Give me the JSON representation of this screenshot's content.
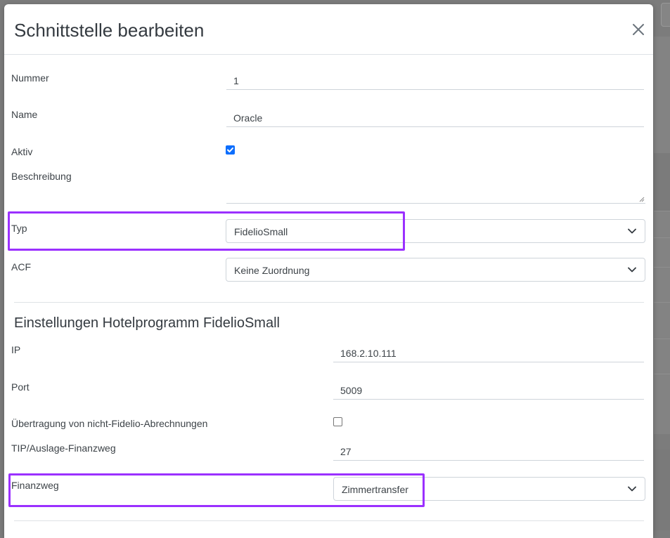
{
  "modal": {
    "title": "Schnittstelle bearbeiten"
  },
  "fields": {
    "nummer": {
      "label": "Nummer",
      "value": "1"
    },
    "name": {
      "label": "Name",
      "value": "Oracle"
    },
    "aktiv": {
      "label": "Aktiv",
      "checked": true
    },
    "beschreibung": {
      "label": "Beschreibung",
      "value": ""
    },
    "typ": {
      "label": "Typ",
      "value": "FidelioSmall"
    },
    "acf": {
      "label": "ACF",
      "value": "Keine Zuordnung"
    }
  },
  "section": {
    "title": "Einstellungen Hotelprogramm FidelioSmall",
    "ip": {
      "label": "IP",
      "value": "168.2.10.111"
    },
    "port": {
      "label": "Port",
      "value": "5009"
    },
    "uebertragung": {
      "label": "Übertragung von nicht-Fidelio-Abrechnungen",
      "checked": false
    },
    "tip": {
      "label": "TIP/Auslage-Finanzweg",
      "value": "27"
    },
    "finanzweg": {
      "label": "Finanzweg",
      "value": "Zimmertransfer"
    }
  },
  "colors": {
    "highlight": "#9b30ff",
    "checkbox_accent": "#0d6efd",
    "overlay": "#7d7d7d"
  },
  "icons": {
    "close": "close-icon",
    "select_arrow": "chevron-down-icon",
    "checkmark": "checkmark-icon"
  }
}
